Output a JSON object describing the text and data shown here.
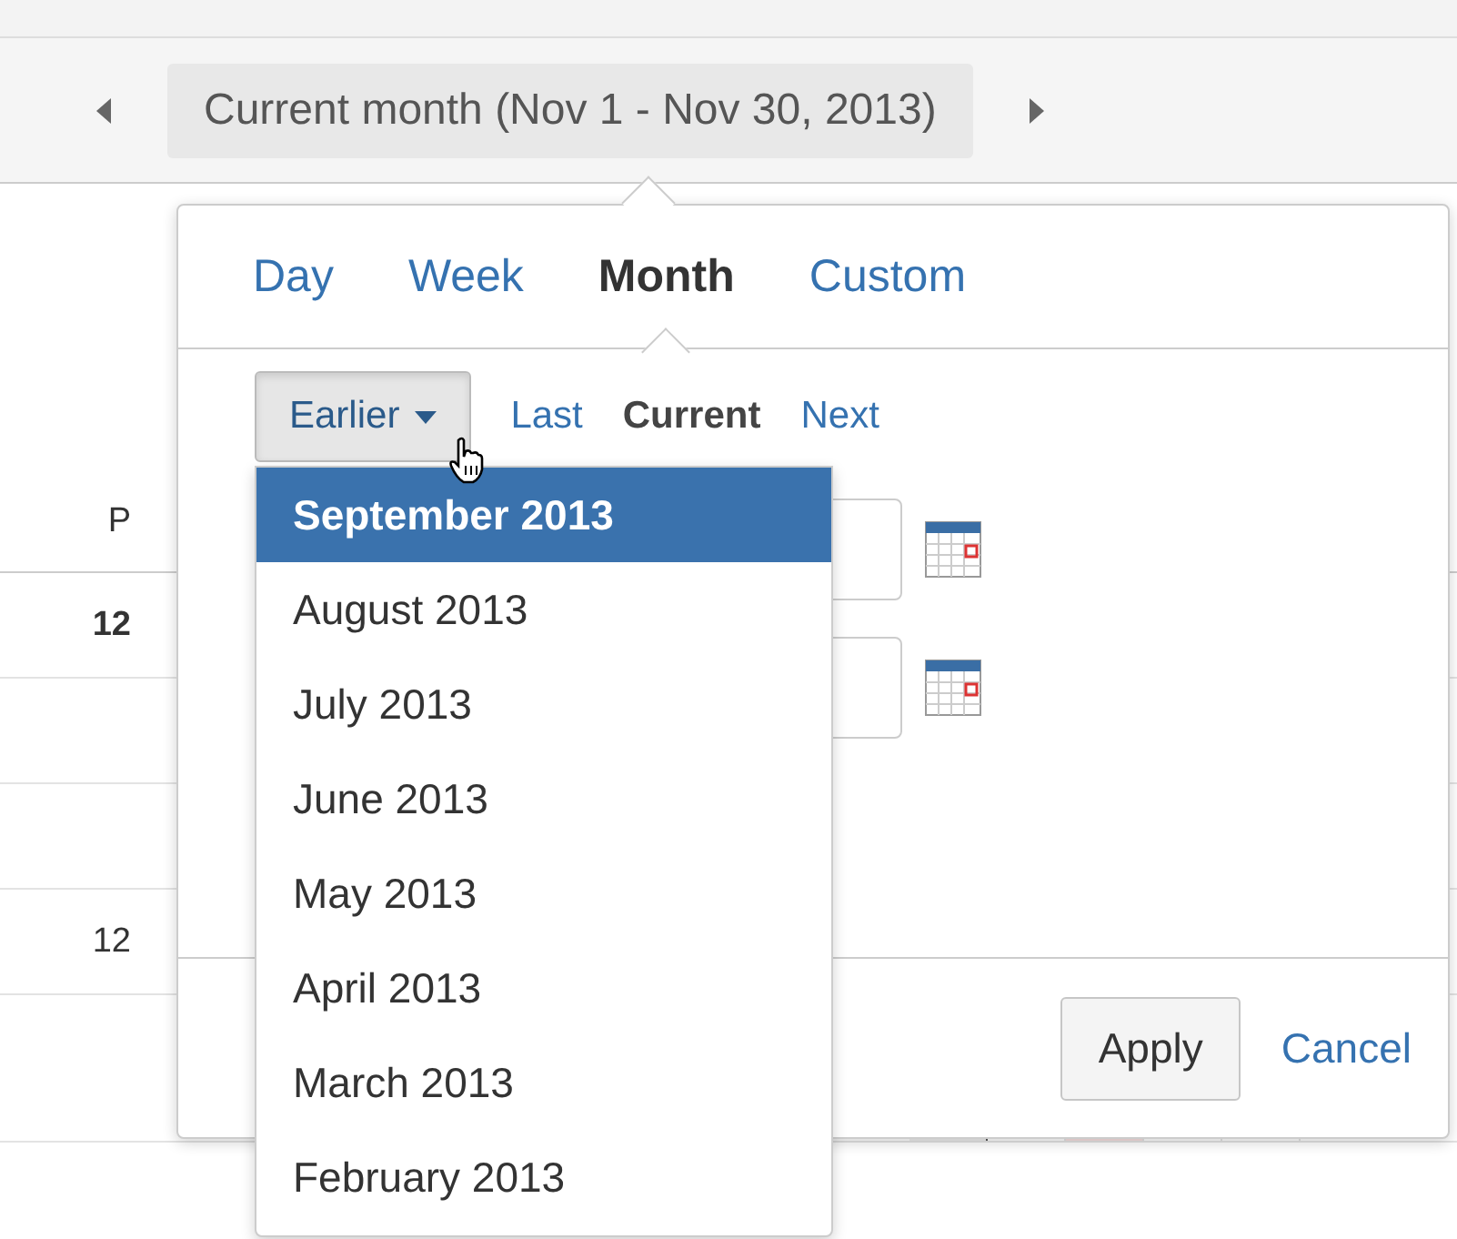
{
  "nav": {
    "period_label": "Current month (Nov 1 - Nov 30, 2013)"
  },
  "background_table": {
    "column_header": "P",
    "cells": [
      {
        "text": "12",
        "bold": true
      },
      {
        "text": "12",
        "bold": false
      }
    ]
  },
  "popover": {
    "tabs": [
      {
        "label": "Day",
        "selected": false
      },
      {
        "label": "Week",
        "selected": false
      },
      {
        "label": "Month",
        "selected": true
      },
      {
        "label": "Custom",
        "selected": false
      }
    ],
    "earlier_button": {
      "label": "Earlier",
      "expanded": true
    },
    "range_links": [
      {
        "label": "Last",
        "selected": false
      },
      {
        "label": "Current",
        "selected": true
      },
      {
        "label": "Next",
        "selected": false
      }
    ],
    "menu_items": [
      {
        "label": "September 2013",
        "selected": true
      },
      {
        "label": "August 2013",
        "selected": false
      },
      {
        "label": "July 2013",
        "selected": false
      },
      {
        "label": "June 2013",
        "selected": false
      },
      {
        "label": "May 2013",
        "selected": false
      },
      {
        "label": "April 2013",
        "selected": false
      },
      {
        "label": "March 2013",
        "selected": false
      },
      {
        "label": "February 2013",
        "selected": false
      }
    ],
    "apply_button": "Apply",
    "cancel_link": "Cancel"
  }
}
